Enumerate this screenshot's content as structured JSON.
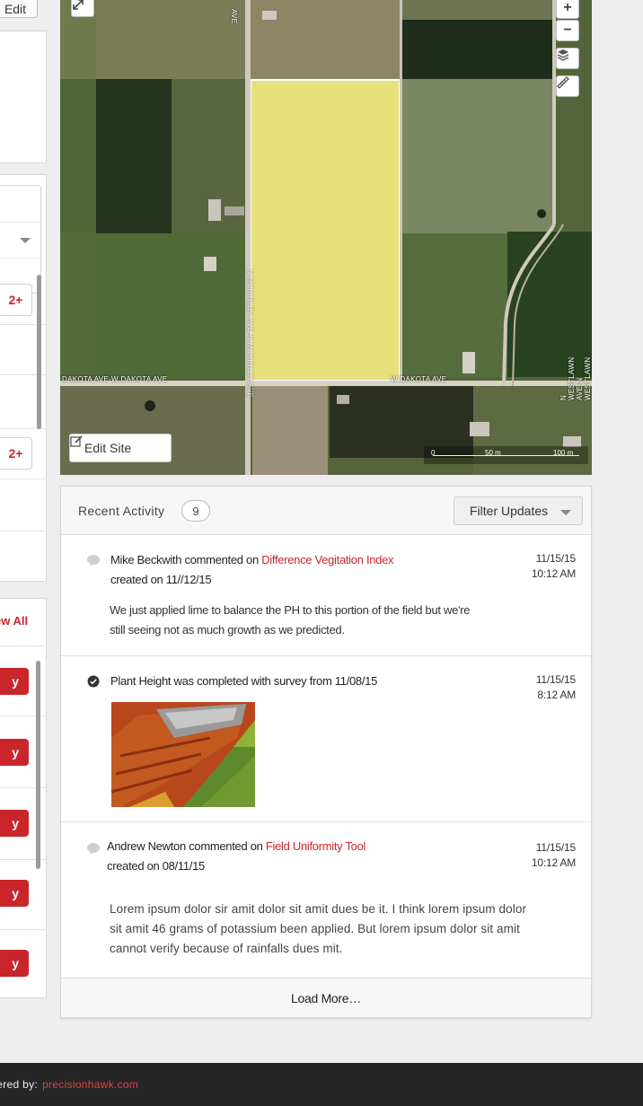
{
  "left": {
    "edit_label": "Edit",
    "badge_a": "2+",
    "badge_b": "2+",
    "view_all": "ew All",
    "buttons": [
      "y",
      "y",
      "y",
      "y",
      "y"
    ]
  },
  "map": {
    "roads": {
      "dakota_left": "DAKOTA AVE-W DAKOTA AVE",
      "dakota_right": "W DAKOTA AVE",
      "vertical_left": "AVE",
      "vertical_mid": "N MCKINLEY AVE-N MCKINLEY AVE",
      "westlawn": "N WESTLAWN AVE-N WESTLAWN AVE"
    },
    "zoom_in": "+",
    "zoom_out": "−",
    "edit_site_label": "Edit Site",
    "scale": {
      "zero": "0",
      "mid": "50 m",
      "end": "100 m"
    }
  },
  "activity": {
    "title": "Recent Activity",
    "count": "9",
    "filter_label": "Filter Updates",
    "items": [
      {
        "author": "Mike Beckwith",
        "action": " commented on ",
        "link": "Difference Vegitation Index",
        "created": "created on 11//12/15",
        "date": "11/15/15",
        "time": "10:12 AM",
        "body_1": "We just applied lime to balance the PH to this portion of the field but we're",
        "body_2": "still seeing not as much growth as we predicted."
      },
      {
        "text": "Plant Height was completed with survey from 11/08/15",
        "date": "11/15/15",
        "time": "8:12 AM"
      },
      {
        "author": "Andrew Newton",
        "action": " commented on ",
        "link": "Field Uniformity Tool",
        "created": "created on 08/11/15",
        "date": "11/15/15",
        "time": "10:12 AM",
        "body_1": "Lorem ipsum dolor sir amit dolor sit amit dues be it. I think lorem ipsum dolor",
        "body_2": "sit amit 46 grams of potassium been applied. But lorem ipsum dolor sit amit",
        "body_3": "cannot verify because of rainfalls dues mit."
      }
    ],
    "load_more": "Load More…"
  },
  "footer": {
    "prefix": "vered by:",
    "brand": "precisionhawk.com"
  },
  "colors": {
    "accent": "#c8262b",
    "field_highlight": "#e6e07a",
    "footer_bg": "#262626"
  }
}
